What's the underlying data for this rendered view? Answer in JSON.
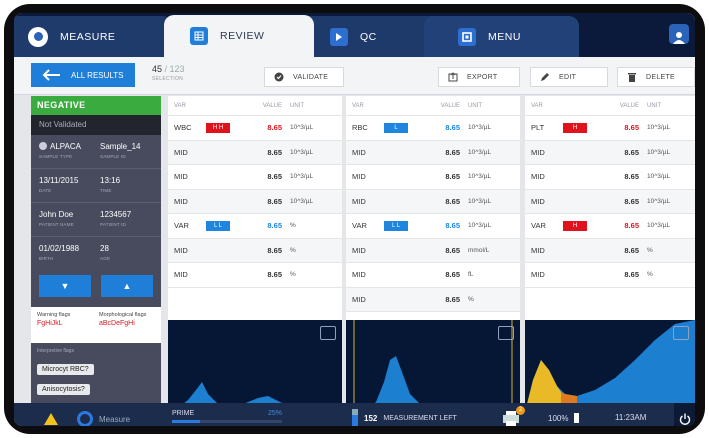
{
  "tabs": {
    "measure": "MEASURE",
    "review": "REVIEW",
    "qc": "QC",
    "menu": "MENU"
  },
  "toolbar": {
    "all_results": "ALL RESULTS",
    "selection_current": "45",
    "selection_total": "/ 123",
    "selection_label": "SELECTION",
    "validate": "VALIDATE",
    "export": "EXPORT",
    "edit": "EDIT",
    "delete": "DELETE"
  },
  "sample": {
    "status": "NEGATIVE",
    "validation": "Not Validated",
    "sample_type": "ALPACA",
    "sample_type_label": "SAMPLE TYPE",
    "sample_id": "Sample_14",
    "sample_id_label": "SAMPLE ID",
    "date": "13/11/2015",
    "date_label": "DATE",
    "time": "13:16",
    "time_label": "TIME",
    "patient_name": "John Doe",
    "patient_name_label": "PATIENT NAME",
    "patient_id": "1234567",
    "patient_id_label": "PATIENT ID",
    "birth": "01/02/1988",
    "birth_label": "BIRTH",
    "age": "28",
    "age_label": "AGE"
  },
  "flags": {
    "warning_label": "Warning flags",
    "warning_value": "FgHiJkL",
    "morph_label": "Morphological flags",
    "morph_value": "aBcDeFgHi",
    "interp_label": "Interpretive flags",
    "interp": [
      "Microcyt RBC?",
      "Anisocytosis?"
    ]
  },
  "columns": {
    "var": "VAR",
    "value": "VALUE",
    "unit": "UNIT"
  },
  "tables": [
    {
      "rows": [
        {
          "var": "WBC",
          "flag": "H H",
          "flag_color": "#e0121e",
          "value": "8.65",
          "value_color": "#e0121e",
          "unit": "10^3/µL"
        },
        {
          "var": "MID",
          "flag": "",
          "value": "8.65",
          "unit": "10^3/µL"
        },
        {
          "var": "MID",
          "flag": "",
          "value": "8.65",
          "unit": "10^3/µL"
        },
        {
          "var": "MID",
          "flag": "",
          "value": "8.65",
          "unit": "10^3/µL"
        },
        {
          "var": "VAR",
          "flag": "L L",
          "flag_color": "#1f86df",
          "value": "8.65",
          "value_color": "#1f86df",
          "unit": "%"
        },
        {
          "var": "MID",
          "flag": "",
          "value": "8.65",
          "unit": "%"
        },
        {
          "var": "MID",
          "flag": "",
          "value": "8.65",
          "unit": "%"
        }
      ]
    },
    {
      "rows": [
        {
          "var": "RBC",
          "flag": "L",
          "flag_color": "#1f86df",
          "value": "8.65",
          "value_color": "#1f86df",
          "unit": "10^3/µL"
        },
        {
          "var": "MID",
          "flag": "",
          "value": "8.65",
          "unit": "10^3/µL"
        },
        {
          "var": "MID",
          "flag": "",
          "value": "8.65",
          "unit": "10^3/µL"
        },
        {
          "var": "MID",
          "flag": "",
          "value": "8.65",
          "unit": "10^3/µL"
        },
        {
          "var": "VAR",
          "flag": "L L",
          "flag_color": "#1f86df",
          "value": "8.65",
          "value_color": "#1f86df",
          "unit": "10^3/µL"
        },
        {
          "var": "MID",
          "flag": "",
          "value": "8.65",
          "unit": "mmol/L"
        },
        {
          "var": "MID",
          "flag": "",
          "value": "8.65",
          "unit": "fL"
        },
        {
          "var": "MID",
          "flag": "",
          "value": "8.65",
          "unit": "%"
        }
      ]
    },
    {
      "rows": [
        {
          "var": "PLT",
          "flag": "H",
          "flag_color": "#e0121e",
          "value": "8.65",
          "value_color": "#e0121e",
          "unit": "10^3/µL"
        },
        {
          "var": "MID",
          "flag": "",
          "value": "8.65",
          "unit": "10^3/µL"
        },
        {
          "var": "MID",
          "flag": "",
          "value": "8.65",
          "unit": "10^3/µL"
        },
        {
          "var": "MID",
          "flag": "",
          "value": "8.65",
          "unit": "10^3/µL"
        },
        {
          "var": "VAR",
          "flag": "H",
          "flag_color": "#e0121e",
          "value": "8.65",
          "value_color": "#e0121e",
          "unit": "10^3/µL"
        },
        {
          "var": "MID",
          "flag": "",
          "value": "8.65",
          "unit": "%"
        },
        {
          "var": "MID",
          "flag": "",
          "value": "8.65",
          "unit": "%"
        }
      ]
    }
  ],
  "statusbar": {
    "measure": "Measure",
    "prime": "PRIME",
    "prime_percent": "25%",
    "prime_progress": 0.25,
    "measurements": "152",
    "measurements_label": "MEASUREMENT LEFT",
    "printer_count": "2",
    "battery": "100%",
    "time": "11:23AM"
  },
  "icons": {
    "all_results": "arrow-left-icon",
    "validate": "check-circle-icon",
    "export": "export-icon",
    "edit": "pencil-icon",
    "delete": "trash-icon",
    "power": "power-icon",
    "warning": "warning-icon",
    "printer": "printer-icon"
  }
}
